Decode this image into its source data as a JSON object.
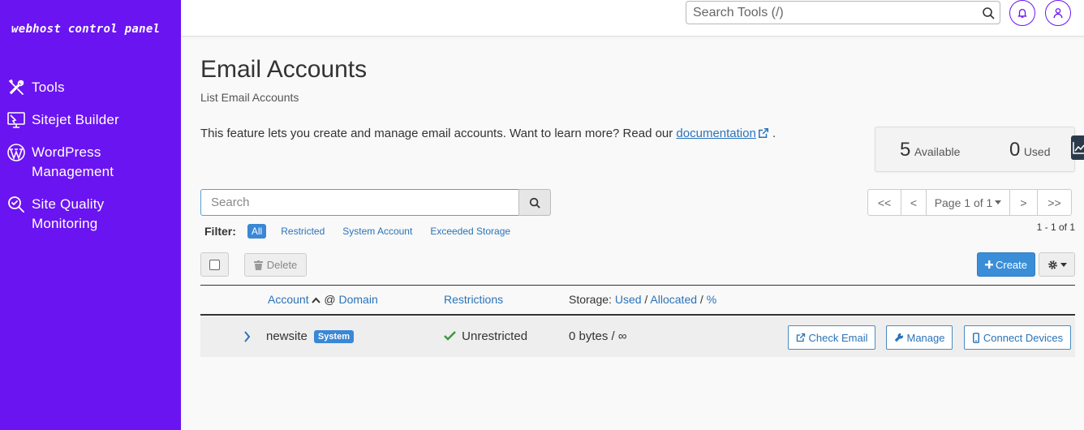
{
  "sidebar": {
    "brand": "webhost control panel",
    "items": [
      {
        "label": "Tools",
        "icon": "tools-icon"
      },
      {
        "label": "Sitejet Builder",
        "icon": "sitejet-icon"
      },
      {
        "label": "WordPress Management",
        "icon": "wordpress-icon"
      },
      {
        "label": "Site Quality Monitoring",
        "icon": "site-quality-icon"
      }
    ],
    "color": "#6a14f2"
  },
  "topbar": {
    "search_placeholder": "Search Tools (/)"
  },
  "page": {
    "title": "Email Accounts",
    "subtitle": "List Email Accounts",
    "intro_text": "This feature lets you create and manage email accounts. Want to learn more? Read our ",
    "intro_link": "documentation",
    "intro_end": "."
  },
  "stats": {
    "available_count": "5",
    "available_label": "Available",
    "used_count": "0",
    "used_label": "Used"
  },
  "search": {
    "placeholder": "Search"
  },
  "pagination": {
    "first": "<<",
    "prev": "<",
    "page_label": "Page 1 of 1",
    "next": ">",
    "last": ">>",
    "range": "1 - 1 of 1"
  },
  "filter": {
    "label": "Filter:",
    "options": [
      "All",
      "Restricted",
      "System Account",
      "Exceeded Storage"
    ],
    "active": "All"
  },
  "actions": {
    "delete": "Delete",
    "create": "Create"
  },
  "table": {
    "headers": {
      "account": "Account",
      "at": "@",
      "domain": "Domain",
      "restrictions": "Restrictions",
      "storage_prefix": "Storage:",
      "used": "Used",
      "sep1": "/",
      "allocated": "Allocated",
      "sep2": "/",
      "percent": "%"
    },
    "rows": [
      {
        "account": "newsite",
        "badge": "System",
        "restriction": "Unrestricted",
        "storage": "0 bytes / ∞",
        "check_email": "Check Email",
        "manage": "Manage",
        "connect": "Connect Devices"
      }
    ]
  },
  "colors": {
    "accent": "#3a87d6",
    "link": "#2a73b8",
    "success": "#3c9a3c"
  }
}
